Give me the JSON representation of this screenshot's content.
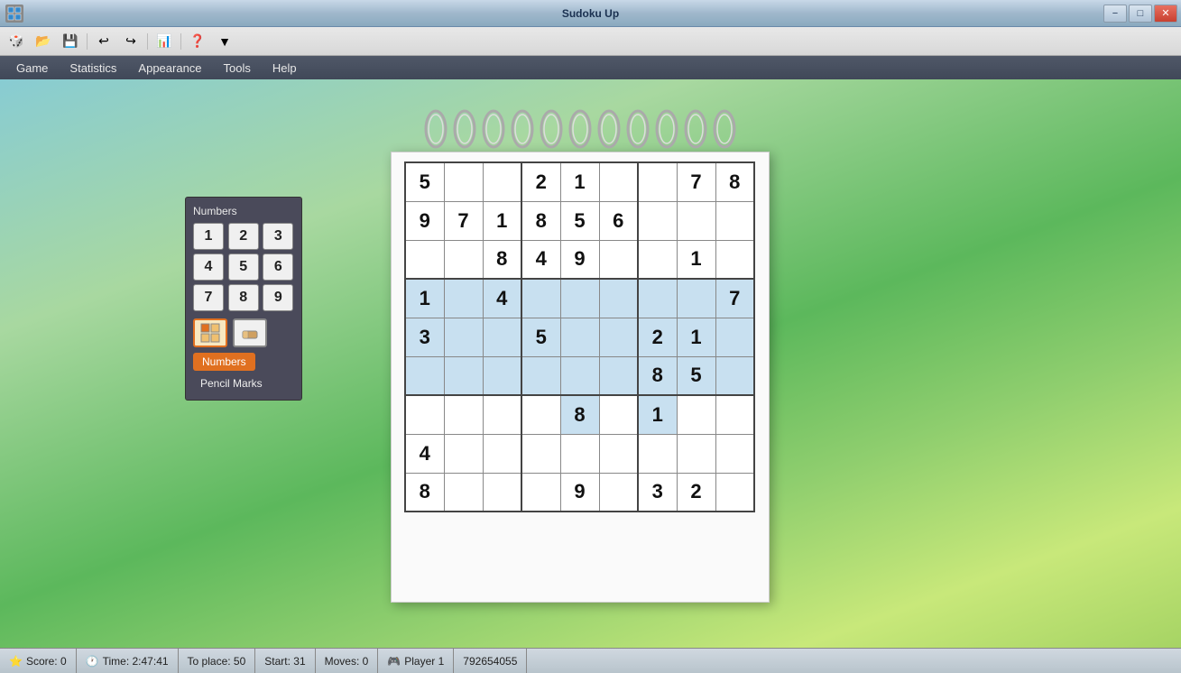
{
  "app": {
    "title": "Sudoku Up"
  },
  "titlebar": {
    "title": "Sudoku Up",
    "minimize": "−",
    "maximize": "□",
    "close": "✕"
  },
  "menubar": {
    "items": [
      "Game",
      "Statistics",
      "Appearance",
      "Tools",
      "Help"
    ]
  },
  "numbers_panel": {
    "title": "Numbers",
    "digits": [
      "1",
      "2",
      "3",
      "4",
      "5",
      "6",
      "7",
      "8",
      "9"
    ],
    "mode_numbers": "Numbers",
    "mode_pencil": "Pencil Marks"
  },
  "statusbar": {
    "score": "Score: 0",
    "time": "Time: 2:47:41",
    "to_place": "To place: 50",
    "start": "Start: 31",
    "moves": "Moves: 0",
    "player": "Player 1",
    "game_id": "792654055"
  },
  "sudoku": {
    "grid": [
      [
        {
          "v": "5",
          "h": false
        },
        {
          "v": "",
          "h": false
        },
        {
          "v": "",
          "h": false
        },
        {
          "v": "2",
          "h": false
        },
        {
          "v": "1",
          "h": false
        },
        {
          "v": "",
          "h": false
        },
        {
          "v": "",
          "h": false
        },
        {
          "v": "7",
          "h": false
        },
        {
          "v": "8",
          "h": false
        }
      ],
      [
        {
          "v": "9",
          "h": false
        },
        {
          "v": "7",
          "h": false
        },
        {
          "v": "1",
          "h": false
        },
        {
          "v": "8",
          "h": false
        },
        {
          "v": "5",
          "h": false
        },
        {
          "v": "6",
          "h": false
        },
        {
          "v": "",
          "h": false
        },
        {
          "v": "",
          "h": false
        },
        {
          "v": "",
          "h": false
        }
      ],
      [
        {
          "v": "",
          "h": false
        },
        {
          "v": "",
          "h": false
        },
        {
          "v": "8",
          "h": false
        },
        {
          "v": "4",
          "h": false
        },
        {
          "v": "9",
          "h": false
        },
        {
          "v": "",
          "h": false
        },
        {
          "v": "",
          "h": false
        },
        {
          "v": "1",
          "h": false
        },
        {
          "v": "",
          "h": false
        }
      ],
      [
        {
          "v": "1",
          "h": true
        },
        {
          "v": "",
          "h": true
        },
        {
          "v": "4",
          "h": true
        },
        {
          "v": "",
          "h": true
        },
        {
          "v": "",
          "h": true
        },
        {
          "v": "",
          "h": true
        },
        {
          "v": "",
          "h": true
        },
        {
          "v": "",
          "h": true
        },
        {
          "v": "7",
          "h": true
        }
      ],
      [
        {
          "v": "3",
          "h": true
        },
        {
          "v": "",
          "h": true
        },
        {
          "v": "",
          "h": true
        },
        {
          "v": "5",
          "h": true
        },
        {
          "v": "",
          "h": true
        },
        {
          "v": "",
          "h": true
        },
        {
          "v": "2",
          "h": true
        },
        {
          "v": "1",
          "h": true
        },
        {
          "v": "",
          "h": true
        }
      ],
      [
        {
          "v": "",
          "h": true
        },
        {
          "v": "",
          "h": true
        },
        {
          "v": "",
          "h": true
        },
        {
          "v": "",
          "h": true
        },
        {
          "v": "",
          "h": true
        },
        {
          "v": "",
          "h": true
        },
        {
          "v": "8",
          "h": true
        },
        {
          "v": "5",
          "h": true
        },
        {
          "v": "",
          "h": true
        }
      ],
      [
        {
          "v": "",
          "h": false
        },
        {
          "v": "",
          "h": false
        },
        {
          "v": "",
          "h": false
        },
        {
          "v": "",
          "h": false
        },
        {
          "v": "8",
          "h": true
        },
        {
          "v": "",
          "h": false
        },
        {
          "v": "1",
          "h": true
        },
        {
          "v": "",
          "h": false
        },
        {
          "v": "",
          "h": false
        }
      ],
      [
        {
          "v": "4",
          "h": false
        },
        {
          "v": "",
          "h": false
        },
        {
          "v": "",
          "h": false
        },
        {
          "v": "",
          "h": false
        },
        {
          "v": "",
          "h": false
        },
        {
          "v": "",
          "h": false
        },
        {
          "v": "",
          "h": false
        },
        {
          "v": "",
          "h": false
        },
        {
          "v": "",
          "h": false
        }
      ],
      [
        {
          "v": "8",
          "h": false
        },
        {
          "v": "",
          "h": false
        },
        {
          "v": "",
          "h": false
        },
        {
          "v": "",
          "h": false
        },
        {
          "v": "9",
          "h": false
        },
        {
          "v": "",
          "h": false
        },
        {
          "v": "3",
          "h": false
        },
        {
          "v": "2",
          "h": false
        },
        {
          "v": "",
          "h": false
        }
      ]
    ]
  }
}
